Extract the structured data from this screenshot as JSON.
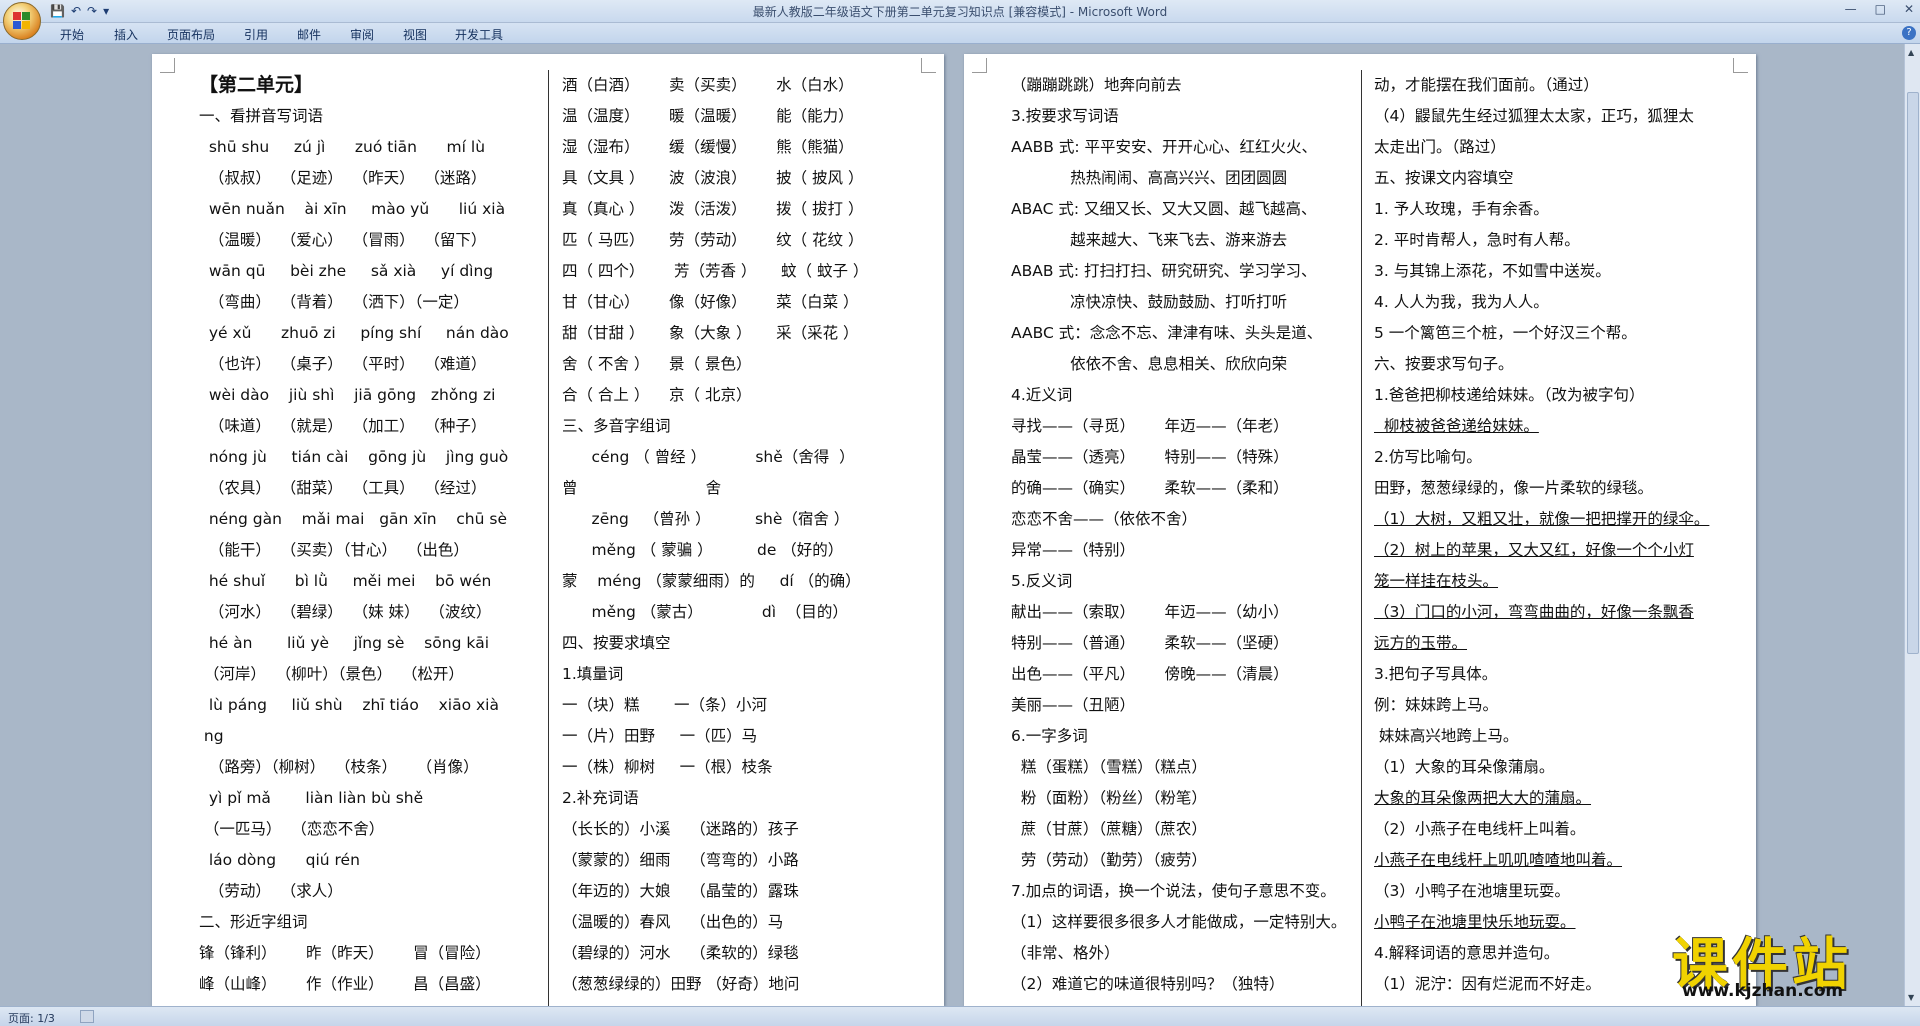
{
  "window": {
    "title": "最新人教版二年级语文下册第二单元复习知识点 [兼容模式] - Microsoft Word",
    "controls": [
      "—",
      "□",
      "✕"
    ]
  },
  "qat": [
    "💾",
    "↶",
    "↷",
    "▾"
  ],
  "tabs": [
    "开始",
    "插入",
    "页面布局",
    "引用",
    "邮件",
    "审阅",
    "视图",
    "开发工具"
  ],
  "status": {
    "page": "页面: 1/3"
  },
  "watermark": {
    "main": "课件站",
    "url": "www.kjzhan.com"
  },
  "page1": {
    "col1": [
      "【第二单元】",
      "一、看拼音写词语",
      "  shū shu     zú jì      zuó tiān      mí lù",
      "  （叔叔）  （足迹）  （昨天）  （迷路）",
      "  wēn nuǎn    ài xīn     mào yǔ      liú xià",
      "  （温暖）  （爱心）  （冒雨）  （留下）",
      "  wān qū     bèi zhe     sǎ xià     yí dìng",
      "  （弯曲）  （背着）  （洒下）（一定）",
      "  yé xǔ      zhuō zi     píng shí     nán dào",
      "  （也许）  （桌子）  （平时）  （难道）",
      "  wèi dào    jiù shì    jiā gōng   zhǒng zi",
      "  （味道）  （就是）  （加工）  （种子）",
      "  nóng jù     tián cài    gōng jù    jìng guò",
      "  （农具）  （甜菜）  （工具）  （经过）",
      "  néng gàn    mǎi mai   gān xīn    chū sè",
      "  （能干）  （买卖）（甘心）  （出色）",
      "  hé shuǐ      bì lǜ     měi mei    bō wén",
      "  （河水）  （碧绿）  （妹 妹）  （波纹）",
      "  hé àn       liǔ yè     jǐng sè    sōng kāi",
      " （河岸）  （柳叶）（景色）  （松开）",
      "  lù páng     liǔ shù    zhī tiáo    xiāo xià",
      " ng",
      "  （路旁）（柳树）  （枝条）    （肖像）",
      "  yì pǐ mǎ       liàn liàn bù shě",
      " （一匹马）  （恋恋不舍）",
      "  láo dòng      qiú rén",
      "  （劳动）  （求人）",
      "二、形近字组词",
      "锋（锋利）      昨（昨天）      冒（冒险）",
      "峰（山峰）      作（作业）      昌（昌盛）"
    ],
    "col2": [
      "酒（白酒）      卖（买卖）      水（白水）",
      "温（温度）      暖（温暖）      能（能力）",
      "湿（湿布）      缓（缓慢）      熊（熊猫）",
      "具（文具 ）     波（波浪）      披（ 披风 ）",
      "真（真心 ）     泼（活泼）      拨（ 拔打 ）",
      "匹（ 马匹）     劳（劳动）      纹（ 花纹 ）",
      "四（ 四个）      芳（芳香 ）     蚊（ 蚊子 ）",
      "甘（甘心）      像（好像）      菜（白菜 ）",
      "甜（甘甜 ）     象（大象 ）     采（采花 ）",
      "舍（ 不舍 ）    景（ 景色）",
      "合（ 合上 ）    京（ 北京）",
      "三、多音字组词",
      "      céng （ 曾经 ）          shě（舍得  ）",
      "曾                          舍",
      "      zēng   （曾孙 ）         shè（宿舍 ）",
      "      měng （ 蒙骗 ）         de （好的）",
      "蒙    méng （蒙蒙细雨）的     dí （的确）",
      "      měng （蒙古）            dì  （目的）",
      "四、按要求填空",
      "1.填量词",
      "一（块）糕       一（条）小河",
      "一（片）田野     一（匹）马",
      "一（株）柳树     一（根）枝条",
      "2.补充词语",
      "（长长的）小溪    （迷路的）孩子",
      "（蒙蒙的）细雨    （弯弯的）小路",
      "（年迈的）大娘    （晶莹的）露珠",
      "（温暖的）春风    （出色的）马",
      "（碧绿的）河水    （柔软的）绿毯",
      "（葱葱绿绿的）田野 （好奇）地问"
    ]
  },
  "page2": {
    "col1": [
      "（蹦蹦跳跳）地奔向前去",
      "3.按要求写词语",
      "AABB 式: 平平安安、开开心心、红红火火、",
      "            热热闹闹、高高兴兴、团团圆圆",
      "ABAC 式: 又细又长、又大又圆、越飞越高、",
      "            越来越大、飞来飞去、游来游去",
      "ABAB 式: 打扫打扫、研究研究、学习学习、",
      "            凉快凉快、鼓励鼓励、打听打听",
      "AABC 式：念念不忘、津津有味、头头是道、",
      "            依依不舍、息息相关、欣欣向荣",
      "4.近义词",
      "寻找——（寻觅）      年迈——（年老）",
      "晶莹——（透亮）      特别——（特殊）",
      "的确——（确实）      柔软——（柔和）",
      "恋恋不舍——（依依不舍）",
      "异常——（特别）",
      "5.反义词",
      "献出——（索取）      年迈——（幼小）",
      "特别——（普通）      柔软——（坚硬）",
      "出色——（平凡）      傍晚——（清晨）",
      "美丽——（丑陋）",
      "6.一字多词",
      "  糕（蛋糕）（雪糕）（糕点）",
      "  粉（面粉）（粉丝）（粉笔）",
      "  蔗（甘蔗）（蔗糖）（蔗农）",
      "  劳（劳动）（勤劳）（疲劳）",
      "7.加点的词语，换一个说法，使句子意思不变。",
      "（1）这样要很多很多人才能做成，一定特别大。",
      "（非常、格外）",
      "（2）难道它的味道很特别吗？（独特）"
    ],
    "col2": [
      "动，才能摆在我们面前。（通过）",
      "（4）鼹鼠先生经过狐狸太太家，正巧，狐狸太",
      "太走出门。（路过）",
      "五、按课文内容填空",
      "1. 予人玫瑰，手有余香。",
      "2. 平时肯帮人，急时有人帮。",
      "3. 与其锦上添花，不如雪中送炭。",
      "4. 人人为我，我为人人。",
      "5 一个篱笆三个桩，一个好汉三个帮。",
      "六、按要求写句子。",
      "1.爸爸把柳枝递给妹妹。（改为被字句）",
      "  柳枝被爸爸递给妹妹。",
      "2.仿写比喻句。",
      "田野，葱葱绿绿的，像一片柔软的绿毯。",
      "（1）大树，又粗又壮，就像一把把撑开的绿伞。",
      "（2）树上的苹果，又大又红，好像一个个小灯",
      "笼一样挂在枝头。",
      "（3）门口的小河，弯弯曲曲的，好像一条飘香",
      "远方的玉带。",
      "3.把句子写具体。",
      "例：妹妹跨上马。",
      " 妹妹高兴地跨上马。",
      "（1）大象的耳朵像蒲扇。",
      "大象的耳朵像两把大大的蒲扇。",
      "（2）小燕子在电线杆上叫着。",
      "小燕子在电线杆上叽叽喳喳地叫着。",
      "（3）小鸭子在池塘里玩耍。",
      "小鸭子在池塘里快乐地玩耍。",
      "4.解释词语的意思并造句。",
      "（1）泥泞：因有烂泥而不好走。"
    ]
  }
}
